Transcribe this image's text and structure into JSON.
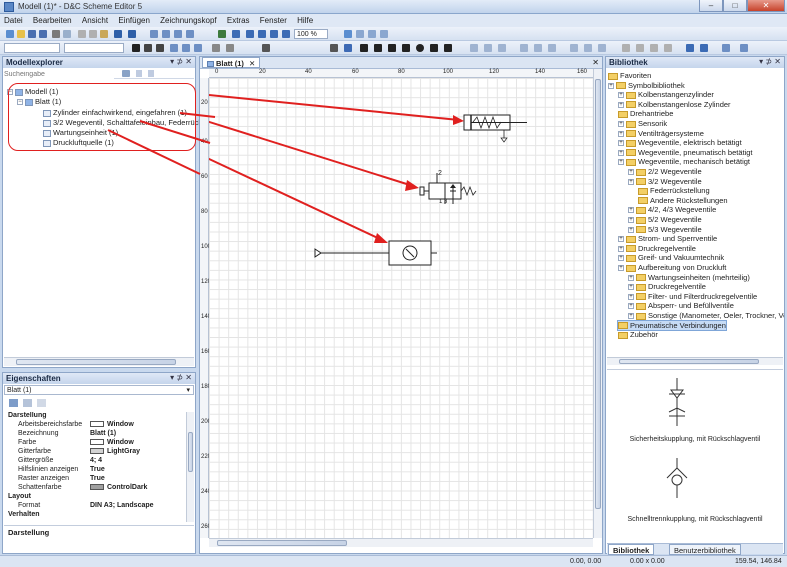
{
  "window": {
    "title": "Modell (1)* - D&C Scheme Editor 5",
    "min_label": "–",
    "max_label": "□",
    "close_label": "✕"
  },
  "menu": [
    "Datei",
    "Bearbeiten",
    "Ansicht",
    "Einfügen",
    "Zeichnungskopf",
    "Extras",
    "Fenster",
    "Hilfe"
  ],
  "toolbar": {
    "zoom_value": "100 %"
  },
  "model_explorer": {
    "title": "Modellexplorer",
    "controls": "▾ ⊅ ✕",
    "search_placeholder": "Sucheingabe",
    "tree": [
      {
        "label": "Modell (1)",
        "level": 0
      },
      {
        "label": "Blatt (1)",
        "level": 1
      },
      {
        "label": "Zylinder einfachwirkend, eingefahren (1)",
        "level": 2
      },
      {
        "label": "3/2 Wegeventil, Schalttafeleinbau, Federrück",
        "level": 2
      },
      {
        "label": "Wartungseinheit (1)",
        "level": 2
      },
      {
        "label": "Druckluftquelle (1)",
        "level": 2
      }
    ]
  },
  "properties": {
    "title": "Eigenschaften",
    "controls": "▾ ⊅ ✕",
    "selected": "Blatt (1)",
    "rows": [
      {
        "key": "Darstellung",
        "value": "",
        "section": true
      },
      {
        "key": "Arbeitsbereichsfarbe",
        "value": "Window",
        "color": "#ffffff"
      },
      {
        "key": "Bezeichnung",
        "value": "Blatt (1)"
      },
      {
        "key": "Farbe",
        "value": "Window",
        "color": "#ffffff"
      },
      {
        "key": "Gitterfarbe",
        "value": "LightGray",
        "color": "#d3d3d3"
      },
      {
        "key": "Gittergröße",
        "value": "4; 4"
      },
      {
        "key": "Hilfslinien anzeigen",
        "value": "True"
      },
      {
        "key": "Raster anzeigen",
        "value": "True"
      },
      {
        "key": "Schattenfarbe",
        "value": "ControlDark",
        "color": "#a0a0a0"
      },
      {
        "key": "Layout",
        "value": "",
        "section": true
      },
      {
        "key": "Format",
        "value": "DIN A3; Landscape"
      },
      {
        "key": "Verhalten",
        "value": "",
        "section": true
      }
    ],
    "description": "Darstellung"
  },
  "document": {
    "tab_label": "Blatt (1)",
    "close": "✕",
    "ruler_x": [
      "0",
      "20",
      "40",
      "60",
      "80",
      "100",
      "120",
      "140",
      "160"
    ],
    "ruler_y": [
      "20",
      "40",
      "60",
      "80",
      "100",
      "120",
      "140",
      "160",
      "180",
      "200",
      "220",
      "240",
      "260"
    ],
    "valve_port_top": "2",
    "valve_port_bottom": "1 3"
  },
  "library": {
    "title": "Bibliothek",
    "controls": "▾ ⊅ ✕",
    "tree": [
      {
        "label": "Favoriten",
        "level": 0
      },
      {
        "label": "Symbolbibliothek",
        "level": 0
      },
      {
        "label": "Kolbenstangenzylinder",
        "level": 1
      },
      {
        "label": "Kolbenstangenlose Zylinder",
        "level": 1
      },
      {
        "label": "Drehantriebe",
        "level": 1
      },
      {
        "label": "Sensorik",
        "level": 1
      },
      {
        "label": "Ventilträgersysteme",
        "level": 1
      },
      {
        "label": "Wegeventile, elektrisch betätigt",
        "level": 1
      },
      {
        "label": "Wegeventile, pneumatisch betätigt",
        "level": 1
      },
      {
        "label": "Wegeventile, mechanisch betätigt",
        "level": 1
      },
      {
        "label": "2/2 Wegeventile",
        "level": 2
      },
      {
        "label": "3/2 Wegeventile",
        "level": 2
      },
      {
        "label": "Federrückstellung",
        "level": 3
      },
      {
        "label": "Andere Rückstellungen",
        "level": 3
      },
      {
        "label": "4/2, 4/3 Wegeventile",
        "level": 2
      },
      {
        "label": "5/2 Wegeventile",
        "level": 2
      },
      {
        "label": "5/3 Wegeventile",
        "level": 2
      },
      {
        "label": "Strom- und Sperrventile",
        "level": 1
      },
      {
        "label": "Druckregelventile",
        "level": 1
      },
      {
        "label": "Greif- und Vakuumtechnik",
        "level": 1
      },
      {
        "label": "Aufbereitung von Druckluft",
        "level": 1
      },
      {
        "label": "Wartungseinheiten (mehrteilig)",
        "level": 2
      },
      {
        "label": "Druckregelventile",
        "level": 2
      },
      {
        "label": "Filter- und Filterdruckregelventile",
        "level": 2
      },
      {
        "label": "Absperr- und Befüllventile",
        "level": 2
      },
      {
        "label": "Sonstige (Manometer, Oeler, Trockner, Ve",
        "level": 2
      },
      {
        "label": "Pneumatische Verbindungen",
        "level": 1
      },
      {
        "label": "Zubehör",
        "level": 1
      }
    ],
    "preview_items": [
      {
        "label": "Sicherheitskupplung, mit Rückschlagventil"
      },
      {
        "label": "Schnelltrennkupplung, mit Rückschlagventil"
      }
    ],
    "tabs": [
      "Bibliothek",
      "Benutzerbibliothek"
    ]
  },
  "status": {
    "pos1": "0.00, 0.00",
    "pos2": "0.00 x 0.00",
    "pos3": "159.54, 146.84"
  },
  "colors": {
    "annotation_red": "#e0201f",
    "panel_header": "#c5d5ec",
    "selection": "#c6dbf5"
  }
}
